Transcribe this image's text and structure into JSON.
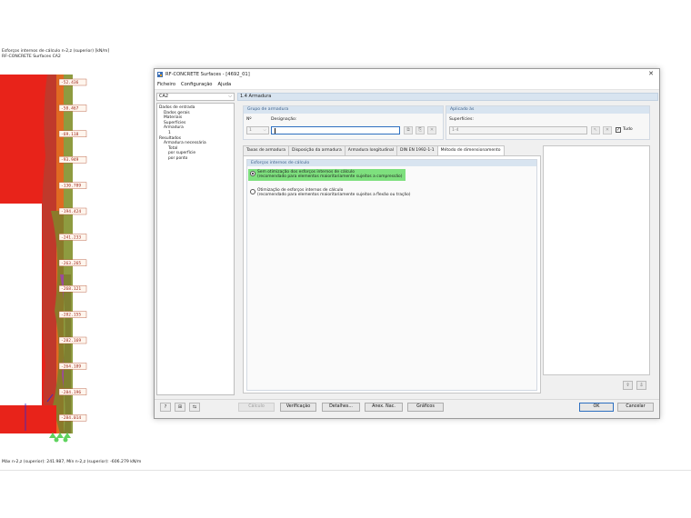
{
  "background": {
    "caption_line1": "Esforços internos de cálculo n-2,z (superior) [kN/m]",
    "caption_line2": "RF-CONCRETE Surfaces CA2",
    "bottom_caption": "Máx n-2,z (superior): 241.987, Mín n-2,z (superior): -606.279 kN/m",
    "labels": [
      "-52.436",
      "-58.467",
      "-69.118",
      "-93.949",
      "-130.789",
      "-194.424",
      "-241.233",
      "-263.265",
      "-268.121",
      "-282.155",
      "-282.169",
      "-264.189",
      "-284.196",
      "-284.014"
    ]
  },
  "dialog": {
    "title": "RF-CONCRETE Surfaces - [4692_01]",
    "menu": [
      "Ficheiro",
      "Configuração",
      "Ajuda"
    ],
    "case_combo": "CA2",
    "tree": [
      {
        "label": "Dados de entrada",
        "indent": 0
      },
      {
        "label": "Dados gerais",
        "indent": 1
      },
      {
        "label": "Materiais",
        "indent": 1
      },
      {
        "label": "Superfícies",
        "indent": 1
      },
      {
        "label": "Armadura",
        "indent": 1
      },
      {
        "label": "1",
        "indent": 2
      },
      {
        "label": "Resultados",
        "indent": 0
      },
      {
        "label": "Armadura necessária",
        "indent": 1
      },
      {
        "label": "Total",
        "indent": 2
      },
      {
        "label": "por superfície",
        "indent": 2
      },
      {
        "label": "por ponto",
        "indent": 2
      }
    ],
    "page_title": "1.4 Armadura",
    "reinforcement_group": {
      "title": "Grupo de armadura",
      "no_label": "Nº",
      "no_value": "1",
      "designation_label": "Designação:"
    },
    "applied_group": {
      "title": "Aplicado às",
      "surfaces_label": "Superfícies:",
      "surfaces_value": "1-4",
      "all_label": "Tudo"
    },
    "tabs": [
      "Taxas de armadura",
      "Disposição da armadura",
      "Armadura longitudinal",
      "DIN EN 1992-1-1",
      "Método de dimensionamento"
    ],
    "method_group_title": "Esforços internos de cálculo",
    "option1_line1": "Sem otimização dos esforços internos de cálculo",
    "option1_line2": "(recomendado para elementos maioritariamente sujeitos a compressão)",
    "option2_line1": "Otimização de esforços internos de cálculo",
    "option2_line2": "(recomendado para elementos maioritariamente sujeitos a flexão ou tração)",
    "buttons": {
      "calc": "Cálculo",
      "check": "Verificação",
      "details": "Detalhes...",
      "annex": "Anex. Nac.",
      "graphics": "Gráficos",
      "ok": "OK",
      "cancel": "Cancelar"
    },
    "colors": {
      "highlight": "#7ee07e",
      "header_blue": "#d8e4f0",
      "focus": "#2d6fc0"
    },
    "icons": [
      "app-icon",
      "close-icon",
      "chevron-down-icon",
      "help-icon",
      "export-icon",
      "import-icon",
      "copy-icon",
      "delete-icon",
      "select-icon"
    ]
  }
}
